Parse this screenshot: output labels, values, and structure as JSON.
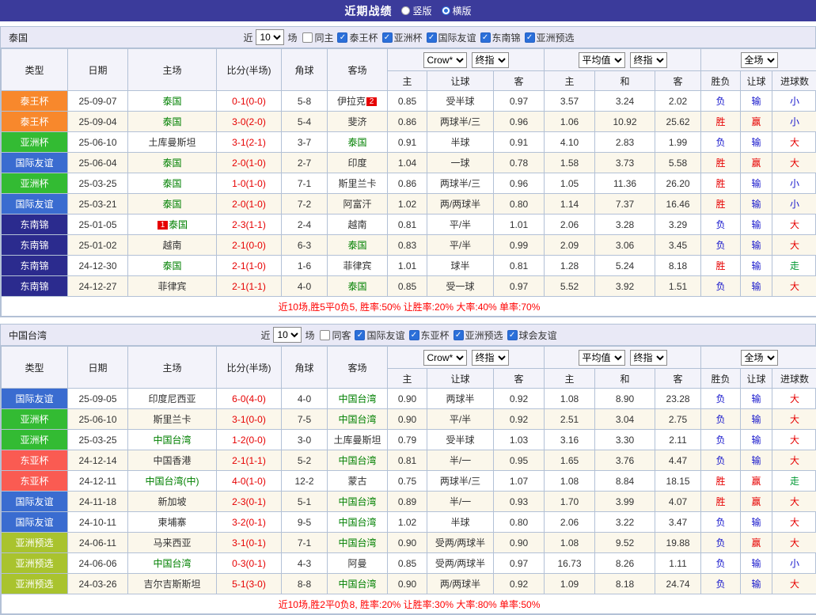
{
  "page": {
    "title": "近期战绩",
    "view_modes": [
      {
        "label": "竖版",
        "selected": false
      },
      {
        "label": "横版",
        "selected": true
      }
    ]
  },
  "table_header": {
    "left_cols": [
      "类型",
      "日期",
      "主场",
      "比分(半场)",
      "角球",
      "客场"
    ],
    "odds_selects": [
      "Crow*",
      "终指"
    ],
    "avg_selects": [
      "平均值",
      "终指"
    ],
    "result_selects": [
      "全场"
    ],
    "sub_cols": [
      "主",
      "让球",
      "客",
      "主",
      "和",
      "客",
      "胜负",
      "让球",
      "进球数"
    ]
  },
  "type_colors": {
    "泰王杯": "#f8882c",
    "亚洲杯": "#33bb33",
    "国际友谊": "#3a6cd0",
    "东南锦": "#2b2b8e",
    "东亚杯": "#fa5b52",
    "亚洲预选": "#a9c32e"
  },
  "sections": [
    {
      "team": "泰国",
      "filter": {
        "near": "近",
        "count": "10",
        "games": "场",
        "checkboxes": [
          {
            "label": "同主",
            "checked": false
          },
          {
            "label": "泰王杯",
            "checked": true
          },
          {
            "label": "亚洲杯",
            "checked": true
          },
          {
            "label": "国际友谊",
            "checked": true
          },
          {
            "label": "东南锦",
            "checked": true
          },
          {
            "label": "亚洲预选",
            "checked": true
          }
        ]
      },
      "rows": [
        {
          "type": "泰王杯",
          "date": "25-09-07",
          "home": "泰国",
          "score": "0-1(0-0)",
          "corner": "5-8",
          "away": "伊拉克",
          "away_badge": "2",
          "odds_home": "0.85",
          "handicap": "受半球",
          "odds_away": "0.97",
          "avg_home": "3.57",
          "avg_draw": "3.24",
          "avg_away": "2.02",
          "result": "负",
          "let_result": "输",
          "goals": "小"
        },
        {
          "type": "泰王杯",
          "date": "25-09-04",
          "home": "泰国",
          "score": "3-0(2-0)",
          "corner": "5-4",
          "away": "斐济",
          "odds_home": "0.86",
          "handicap": "两球半/三",
          "odds_away": "0.96",
          "avg_home": "1.06",
          "avg_draw": "10.92",
          "avg_away": "25.62",
          "result": "胜",
          "let_result": "赢",
          "goals": "小"
        },
        {
          "type": "亚洲杯",
          "date": "25-06-10",
          "home": "土库曼斯坦",
          "score": "3-1(2-1)",
          "corner": "3-7",
          "away": "泰国",
          "odds_home": "0.91",
          "handicap": "半球",
          "odds_away": "0.91",
          "avg_home": "4.10",
          "avg_draw": "2.83",
          "avg_away": "1.99",
          "result": "负",
          "let_result": "输",
          "goals": "大"
        },
        {
          "type": "国际友谊",
          "date": "25-06-04",
          "home": "泰国",
          "score": "2-0(1-0)",
          "corner": "2-7",
          "away": "印度",
          "odds_home": "1.04",
          "handicap": "一球",
          "odds_away": "0.78",
          "avg_home": "1.58",
          "avg_draw": "3.73",
          "avg_away": "5.58",
          "result": "胜",
          "let_result": "赢",
          "goals": "大"
        },
        {
          "type": "亚洲杯",
          "date": "25-03-25",
          "home": "泰国",
          "score": "1-0(1-0)",
          "corner": "7-1",
          "away": "斯里兰卡",
          "odds_home": "0.86",
          "handicap": "两球半/三",
          "odds_away": "0.96",
          "avg_home": "1.05",
          "avg_draw": "11.36",
          "avg_away": "26.20",
          "result": "胜",
          "let_result": "输",
          "goals": "小"
        },
        {
          "type": "国际友谊",
          "date": "25-03-21",
          "home": "泰国",
          "score": "2-0(1-0)",
          "corner": "7-2",
          "away": "阿富汗",
          "odds_home": "1.02",
          "handicap": "两/两球半",
          "odds_away": "0.80",
          "avg_home": "1.14",
          "avg_draw": "7.37",
          "avg_away": "16.46",
          "result": "胜",
          "let_result": "输",
          "goals": "小"
        },
        {
          "type": "东南锦",
          "date": "25-01-05",
          "home": "泰国",
          "home_badge": "1",
          "score": "2-3(1-1)",
          "corner": "2-4",
          "away": "越南",
          "odds_home": "0.81",
          "handicap": "平/半",
          "odds_away": "1.01",
          "avg_home": "2.06",
          "avg_draw": "3.28",
          "avg_away": "3.29",
          "result": "负",
          "let_result": "输",
          "goals": "大"
        },
        {
          "type": "东南锦",
          "date": "25-01-02",
          "home": "越南",
          "score": "2-1(0-0)",
          "corner": "6-3",
          "away": "泰国",
          "odds_home": "0.83",
          "handicap": "平/半",
          "odds_away": "0.99",
          "avg_home": "2.09",
          "avg_draw": "3.06",
          "avg_away": "3.45",
          "result": "负",
          "let_result": "输",
          "goals": "大"
        },
        {
          "type": "东南锦",
          "date": "24-12-30",
          "home": "泰国",
          "score": "2-1(1-0)",
          "corner": "1-6",
          "away": "菲律宾",
          "odds_home": "1.01",
          "handicap": "球半",
          "odds_away": "0.81",
          "avg_home": "1.28",
          "avg_draw": "5.24",
          "avg_away": "8.18",
          "result": "胜",
          "let_result": "输",
          "goals": "走"
        },
        {
          "type": "东南锦",
          "date": "24-12-27",
          "home": "菲律宾",
          "score": "2-1(1-1)",
          "corner": "4-0",
          "away": "泰国",
          "odds_home": "0.85",
          "handicap": "受一球",
          "odds_away": "0.97",
          "avg_home": "5.52",
          "avg_draw": "3.92",
          "avg_away": "1.51",
          "result": "负",
          "let_result": "输",
          "goals": "大"
        }
      ],
      "summary": "近10场,胜5平0负5, 胜率:50% 让胜率:20% 大率:40% 单率:70%"
    },
    {
      "team": "中国台湾",
      "filter": {
        "near": "近",
        "count": "10",
        "games": "场",
        "checkboxes": [
          {
            "label": "同客",
            "checked": false
          },
          {
            "label": "国际友谊",
            "checked": true
          },
          {
            "label": "东亚杯",
            "checked": true
          },
          {
            "label": "亚洲预选",
            "checked": true
          },
          {
            "label": "球会友谊",
            "checked": true
          }
        ]
      },
      "rows": [
        {
          "type": "国际友谊",
          "date": "25-09-05",
          "home": "印度尼西亚",
          "score": "6-0(4-0)",
          "corner": "4-0",
          "away": "中国台湾",
          "odds_home": "0.90",
          "handicap": "两球半",
          "odds_away": "0.92",
          "avg_home": "1.08",
          "avg_draw": "8.90",
          "avg_away": "23.28",
          "result": "负",
          "let_result": "输",
          "goals": "大"
        },
        {
          "type": "亚洲杯",
          "date": "25-06-10",
          "home": "斯里兰卡",
          "score": "3-1(0-0)",
          "corner": "7-5",
          "away": "中国台湾",
          "odds_home": "0.90",
          "handicap": "平/半",
          "odds_away": "0.92",
          "avg_home": "2.51",
          "avg_draw": "3.04",
          "avg_away": "2.75",
          "result": "负",
          "let_result": "输",
          "goals": "大"
        },
        {
          "type": "亚洲杯",
          "date": "25-03-25",
          "home": "中国台湾",
          "score": "1-2(0-0)",
          "corner": "3-0",
          "away": "土库曼斯坦",
          "odds_home": "0.79",
          "handicap": "受半球",
          "odds_away": "1.03",
          "avg_home": "3.16",
          "avg_draw": "3.30",
          "avg_away": "2.11",
          "result": "负",
          "let_result": "输",
          "goals": "大"
        },
        {
          "type": "东亚杯",
          "date": "24-12-14",
          "home": "中国香港",
          "score": "2-1(1-1)",
          "corner": "5-2",
          "away": "中国台湾",
          "odds_home": "0.81",
          "handicap": "半/一",
          "odds_away": "0.95",
          "avg_home": "1.65",
          "avg_draw": "3.76",
          "avg_away": "4.47",
          "result": "负",
          "let_result": "输",
          "goals": "大"
        },
        {
          "type": "东亚杯",
          "date": "24-12-11",
          "home": "中国台湾(中)",
          "score": "4-0(1-0)",
          "corner": "12-2",
          "away": "蒙古",
          "odds_home": "0.75",
          "handicap": "两球半/三",
          "odds_away": "1.07",
          "avg_home": "1.08",
          "avg_draw": "8.84",
          "avg_away": "18.15",
          "result": "胜",
          "let_result": "赢",
          "goals": "走"
        },
        {
          "type": "国际友谊",
          "date": "24-11-18",
          "home": "新加坡",
          "score": "2-3(0-1)",
          "corner": "5-1",
          "away": "中国台湾",
          "odds_home": "0.89",
          "handicap": "半/一",
          "odds_away": "0.93",
          "avg_home": "1.70",
          "avg_draw": "3.99",
          "avg_away": "4.07",
          "result": "胜",
          "let_result": "赢",
          "goals": "大"
        },
        {
          "type": "国际友谊",
          "date": "24-10-11",
          "home": "柬埔寨",
          "score": "3-2(0-1)",
          "corner": "9-5",
          "away": "中国台湾",
          "odds_home": "1.02",
          "handicap": "半球",
          "odds_away": "0.80",
          "avg_home": "2.06",
          "avg_draw": "3.22",
          "avg_away": "3.47",
          "result": "负",
          "let_result": "输",
          "goals": "大"
        },
        {
          "type": "亚洲预选",
          "date": "24-06-11",
          "home": "马来西亚",
          "score": "3-1(0-1)",
          "corner": "7-1",
          "away": "中国台湾",
          "odds_home": "0.90",
          "handicap": "受两/两球半",
          "odds_away": "0.90",
          "avg_home": "1.08",
          "avg_draw": "9.52",
          "avg_away": "19.88",
          "result": "负",
          "let_result": "赢",
          "goals": "大"
        },
        {
          "type": "亚洲预选",
          "date": "24-06-06",
          "home": "中国台湾",
          "score": "0-3(0-1)",
          "corner": "4-3",
          "away": "阿曼",
          "odds_home": "0.85",
          "handicap": "受两/两球半",
          "odds_away": "0.97",
          "avg_home": "16.73",
          "avg_draw": "8.26",
          "avg_away": "1.11",
          "result": "负",
          "let_result": "输",
          "goals": "小"
        },
        {
          "type": "亚洲预选",
          "date": "24-03-26",
          "home": "吉尔吉斯斯坦",
          "score": "5-1(3-0)",
          "corner": "8-8",
          "away": "中国台湾",
          "odds_home": "0.90",
          "handicap": "两/两球半",
          "odds_away": "0.92",
          "avg_home": "1.09",
          "avg_draw": "8.18",
          "avg_away": "24.74",
          "result": "负",
          "let_result": "输",
          "goals": "大"
        }
      ],
      "summary": "近10场,胜2平0负8, 胜率:20% 让胜率:30% 大率:80% 单率:50%"
    }
  ]
}
